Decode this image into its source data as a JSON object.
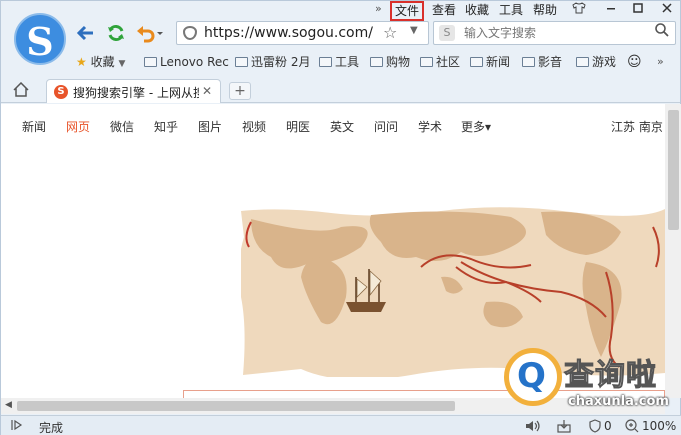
{
  "menu": {
    "chevron": "»",
    "items": [
      "文件",
      "查看",
      "收藏",
      "工具",
      "帮助"
    ],
    "highlighted": "文件"
  },
  "window_controls": [
    "shirt-icon",
    "minimize-icon",
    "maximize-icon",
    "close-icon"
  ],
  "address_bar": {
    "url": "https://www.sogou.com/"
  },
  "search": {
    "placeholder": "输入文字搜索",
    "engine_letter": "S"
  },
  "bookmarks": {
    "favorites_label": "收藏",
    "items": [
      "Lenovo Rec",
      "迅雷粉 2月",
      "工具",
      "购物",
      "社区",
      "新闻",
      "影音",
      "游戏"
    ]
  },
  "tab": {
    "title": "搜狗搜索引擎 - 上网从搜",
    "favicon_letter": "S",
    "new_tab": "+"
  },
  "page_nav": {
    "items": [
      "新闻",
      "网页",
      "微信",
      "知乎",
      "图片",
      "视频",
      "明医",
      "英文",
      "问问",
      "学术",
      "更多▾"
    ],
    "active": "网页",
    "location": "江苏 南京"
  },
  "status_bar": {
    "text": "完成",
    "badge_count": "0",
    "zoom": "100%"
  },
  "watermark": {
    "cn": "查询啦",
    "en": "chaxunla.com",
    "letter": "Q"
  },
  "colors": {
    "accent": "#e8542a",
    "highlight_box": "#d9302b",
    "logo": "#3d8de0"
  }
}
